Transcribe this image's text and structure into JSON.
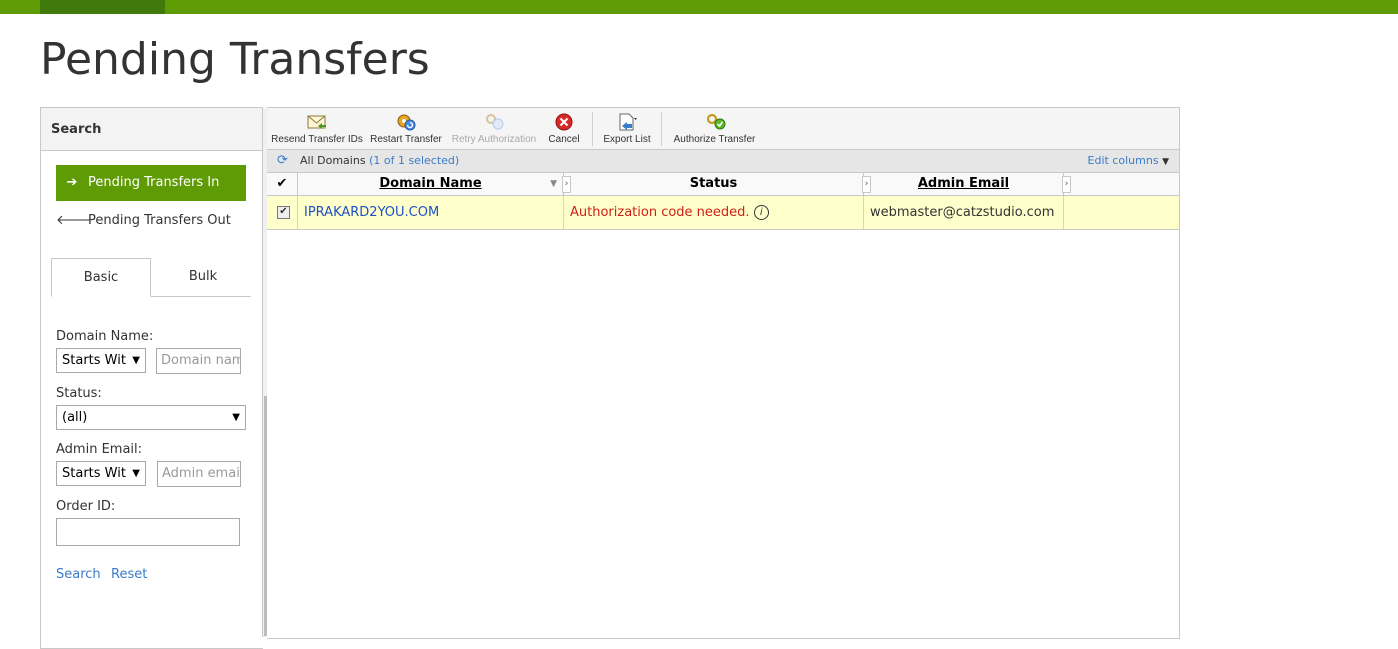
{
  "page": {
    "title": "Pending Transfers"
  },
  "sidebar": {
    "search_label": "Search",
    "nav": [
      {
        "label": "Pending Transfers In",
        "active": true
      },
      {
        "label": "Pending Transfers Out",
        "active": false
      }
    ],
    "tabs": [
      "Basic",
      "Bulk"
    ],
    "form": {
      "domain_name_label": "Domain Name:",
      "domain_name_mode": "Starts Wit",
      "domain_name_placeholder": "Domain nam",
      "status_label": "Status:",
      "status_value": "(all)",
      "admin_email_label": "Admin Email:",
      "admin_email_mode": "Starts Wit",
      "admin_email_placeholder": "Admin email",
      "order_id_label": "Order ID:",
      "order_id_value": ""
    },
    "actions": {
      "search": "Search",
      "reset": "Reset"
    }
  },
  "toolbar": {
    "resend": "Resend Transfer IDs",
    "restart": "Restart Transfer",
    "retry": "Retry Authorization",
    "cancel": "Cancel",
    "export": "Export List",
    "authorize": "Authorize Transfer"
  },
  "grid": {
    "scope": "All Domains",
    "selection": "(1 of 1 selected)",
    "edit_columns": "Edit columns",
    "columns": [
      "Domain Name",
      "Status",
      "Admin Email"
    ],
    "rows": [
      {
        "checked": true,
        "domain": "IPRAKARD2YOU.COM",
        "status": "Authorization code needed.",
        "admin_email": "webmaster@catzstudio.com"
      }
    ]
  },
  "colors": {
    "brand_green": "#5f9b05",
    "link_blue": "#3a7bc8",
    "status_red": "#d0201e",
    "selected_row": "#ffffcc"
  }
}
